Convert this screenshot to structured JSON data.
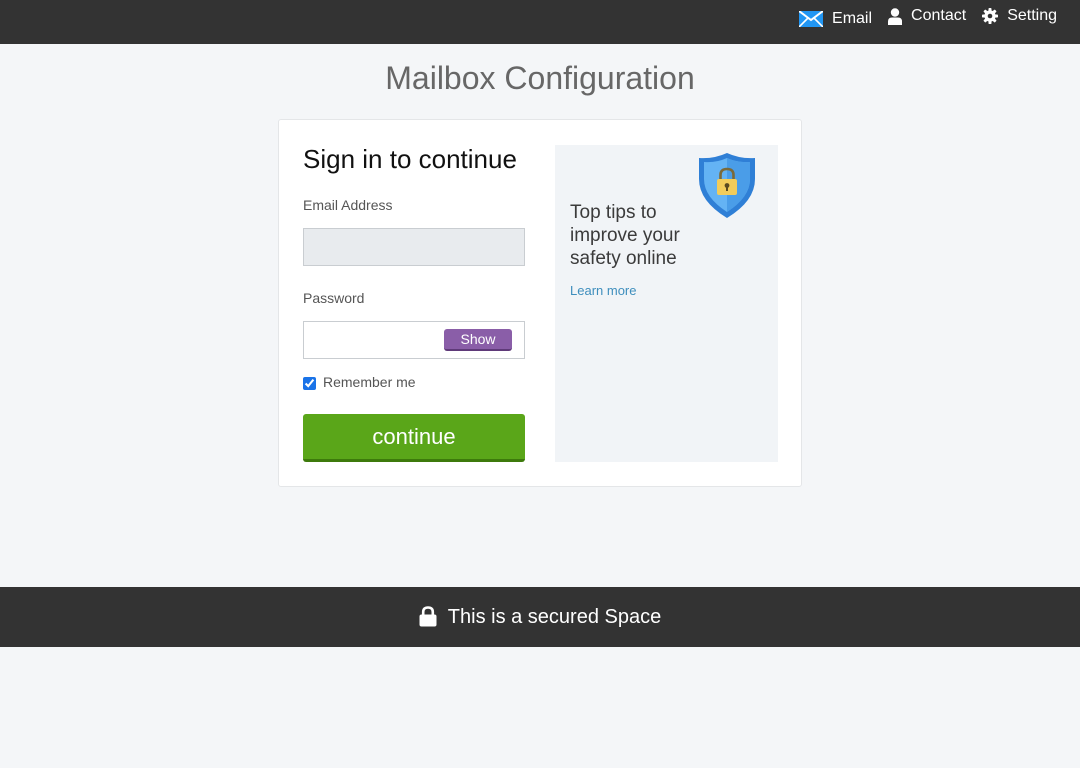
{
  "topnav": {
    "email_label": "Email",
    "contact_label": "Contact",
    "setting_label": "Setting",
    "icons": {
      "email": "envelope-icon",
      "contact": "user-icon",
      "setting": "gear-icon"
    }
  },
  "page": {
    "title": "Mailbox Configuration"
  },
  "signin": {
    "heading": "Sign in to continue",
    "email_label": "Email Address",
    "email_value": "",
    "password_label": "Password",
    "password_value": "",
    "show_label": "Show",
    "remember_label": "Remember me",
    "remember_checked": true,
    "continue_label": "continue"
  },
  "tips": {
    "text": "Top tips to improve your safety online",
    "link_label": "Learn more",
    "icon": "shield-lock-icon"
  },
  "footer": {
    "text": "This is a secured Space",
    "icon": "lock-icon"
  },
  "colors": {
    "bar_bg": "#333333",
    "page_bg": "#f4f6f8",
    "continue_green": "#5aa619",
    "show_purple": "#8a5ea8",
    "link_blue": "#3e8ebd",
    "shield_blue": "#3f8fe0"
  }
}
